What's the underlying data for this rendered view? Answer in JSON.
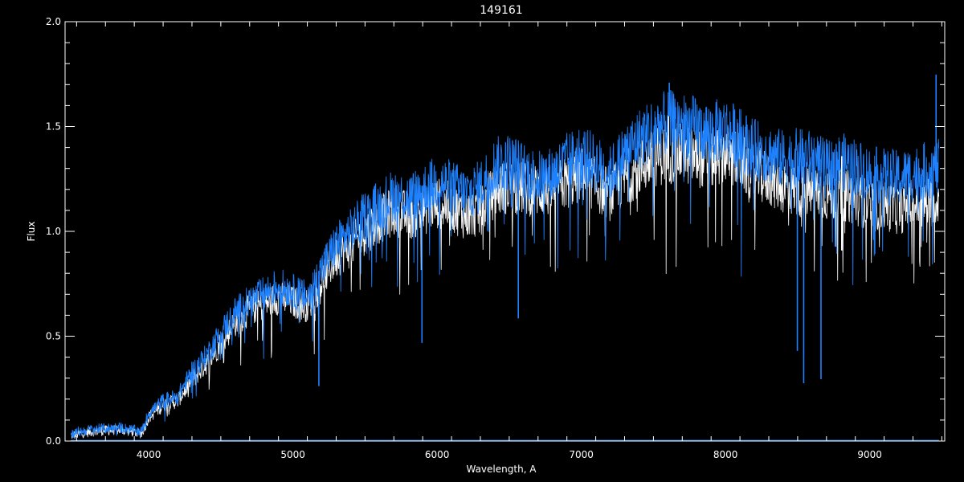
{
  "chart_data": {
    "type": "line",
    "title": "149161",
    "xlabel": "Wavelength, A",
    "ylabel": "Flux",
    "xlim": [
      3420,
      9520
    ],
    "ylim": [
      0.0,
      2.0
    ],
    "grid": false,
    "background": "#000000",
    "x_ticks": [
      {
        "value": 4000,
        "label": "4000"
      },
      {
        "value": 5000,
        "label": "5000"
      },
      {
        "value": 6000,
        "label": "6000"
      },
      {
        "value": 7000,
        "label": "7000"
      },
      {
        "value": 8000,
        "label": "8000"
      },
      {
        "value": 9000,
        "label": "9000"
      }
    ],
    "y_ticks": [
      {
        "value": 0.0,
        "label": "0.0"
      },
      {
        "value": 0.5,
        "label": "0.5"
      },
      {
        "value": 1.0,
        "label": "1.0"
      },
      {
        "value": 1.5,
        "label": "1.5"
      },
      {
        "value": 2.0,
        "label": "2.0"
      }
    ],
    "series": [
      {
        "color": "#ffffff",
        "x": [
          3460,
          3600,
          3800,
          3950,
          4000,
          4100,
          4200,
          4300,
          4400,
          4500,
          4600,
          4700,
          4800,
          4900,
          5000,
          5100,
          5200,
          5300,
          5400,
          5500,
          5600,
          5700,
          5800,
          5900,
          6000,
          6100,
          6200,
          6300,
          6400,
          6500,
          6600,
          6700,
          6800,
          6900,
          7000,
          7100,
          7200,
          7300,
          7400,
          7500,
          7600,
          7700,
          7800,
          7900,
          8000,
          8100,
          8200,
          8300,
          8400,
          8500,
          8600,
          8700,
          8800,
          8900,
          9000,
          9100,
          9200,
          9300,
          9400,
          9480
        ],
        "y": [
          0.03,
          0.05,
          0.06,
          0.04,
          0.12,
          0.18,
          0.2,
          0.3,
          0.38,
          0.48,
          0.58,
          0.64,
          0.67,
          0.7,
          0.68,
          0.66,
          0.78,
          0.9,
          0.95,
          1.02,
          1.08,
          1.12,
          1.1,
          1.12,
          1.16,
          1.14,
          1.1,
          1.12,
          1.22,
          1.24,
          1.23,
          1.22,
          1.22,
          1.26,
          1.3,
          1.25,
          1.2,
          1.28,
          1.33,
          1.38,
          1.4,
          1.4,
          1.38,
          1.37,
          1.4,
          1.36,
          1.3,
          1.28,
          1.24,
          1.22,
          1.22,
          1.2,
          1.2,
          1.18,
          1.15,
          1.15,
          1.13,
          1.15,
          1.16,
          1.18
        ]
      },
      {
        "color": "#1e82ff",
        "x": [
          3460,
          3600,
          3800,
          3950,
          4000,
          4100,
          4200,
          4300,
          4400,
          4500,
          4600,
          4700,
          4800,
          4900,
          5000,
          5100,
          5200,
          5300,
          5400,
          5500,
          5600,
          5700,
          5800,
          5900,
          6000,
          6100,
          6200,
          6300,
          6400,
          6500,
          6600,
          6700,
          6800,
          6900,
          7000,
          7100,
          7200,
          7300,
          7400,
          7500,
          7600,
          7700,
          7800,
          7900,
          8000,
          8100,
          8200,
          8300,
          8400,
          8500,
          8600,
          8700,
          8800,
          8900,
          9000,
          9100,
          9200,
          9300,
          9400,
          9480
        ],
        "y": [
          0.04,
          0.06,
          0.07,
          0.05,
          0.14,
          0.2,
          0.22,
          0.34,
          0.42,
          0.53,
          0.63,
          0.68,
          0.72,
          0.76,
          0.73,
          0.7,
          0.84,
          0.96,
          1.02,
          1.1,
          1.15,
          1.2,
          1.18,
          1.22,
          1.26,
          1.24,
          1.2,
          1.24,
          1.34,
          1.36,
          1.32,
          1.28,
          1.3,
          1.36,
          1.4,
          1.35,
          1.3,
          1.4,
          1.47,
          1.52,
          1.55,
          1.54,
          1.52,
          1.5,
          1.52,
          1.47,
          1.42,
          1.4,
          1.37,
          1.38,
          1.37,
          1.33,
          1.36,
          1.34,
          1.3,
          1.29,
          1.28,
          1.3,
          1.32,
          1.33
        ]
      }
    ],
    "absorption_lines": [
      {
        "x": 5180,
        "depth": 0.55,
        "color": "#1e82ff"
      },
      {
        "x": 5895,
        "depth": 0.75,
        "color": "#1e82ff"
      },
      {
        "x": 6563,
        "depth": 0.75,
        "color": "#1e82ff"
      },
      {
        "x": 7605,
        "depth": 0.25,
        "color": "#ffffff"
      },
      {
        "x": 8498,
        "depth": 0.95,
        "color": "#1e82ff"
      },
      {
        "x": 8542,
        "depth": 1.1,
        "color": "#1e82ff"
      },
      {
        "x": 8662,
        "depth": 1.05,
        "color": "#1e82ff"
      },
      {
        "x": 8806,
        "depth": 0.45,
        "color": "#ffffff"
      }
    ],
    "emission_spikes": [
      {
        "x": 7610,
        "height": 0.16,
        "color": "#1e82ff"
      },
      {
        "x": 9460,
        "height": 0.42,
        "color": "#1e82ff"
      }
    ]
  }
}
